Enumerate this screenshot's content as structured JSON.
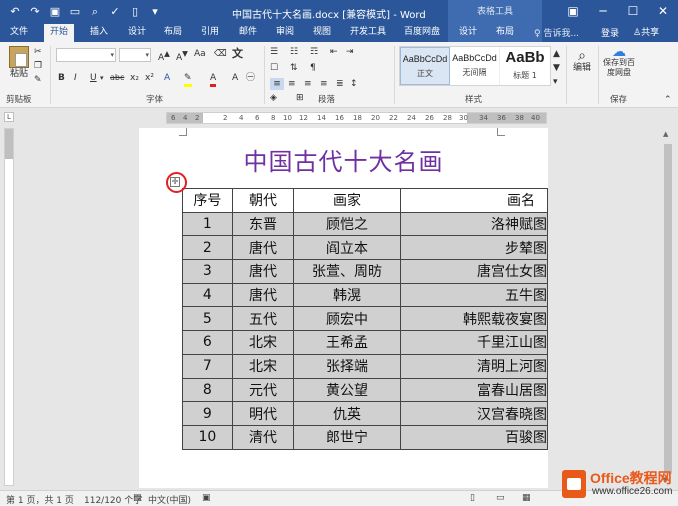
{
  "window": {
    "title": "中国古代十大名画.docx [兼容模式] - Word",
    "context_group": "表格工具"
  },
  "tabs": [
    "文件",
    "开始",
    "插入",
    "设计",
    "布局",
    "引用",
    "邮件",
    "审阅",
    "视图",
    "开发工具",
    "百度网盘",
    "设计",
    "布局"
  ],
  "active_tab": "开始",
  "tell_me": "告诉我...",
  "login": "登录",
  "share": "共享",
  "ribbon": {
    "groups": {
      "clipboard": "剪贴板",
      "font": "字体",
      "paragraph": "段落",
      "styles": "样式",
      "save": "保存"
    },
    "paste_label": "粘贴",
    "edit_label": "编辑",
    "save_to_baidu": "保存到百度网盘",
    "styles": [
      {
        "sample": "AaBbCcDd",
        "name": "正文"
      },
      {
        "sample": "AaBbCcDd",
        "name": "无间隔"
      },
      {
        "sample": "AaBb",
        "name": "标题 1"
      }
    ],
    "font_buttons": {
      "bold": "B",
      "italic": "I",
      "underline": "U",
      "strike": "abc",
      "sub": "x₂",
      "sup": "x²"
    }
  },
  "document": {
    "heading": "中国古代十大名画",
    "headers": [
      "序号",
      "朝代",
      "画家",
      "画名"
    ],
    "rows": [
      [
        "1",
        "东晋",
        "顾恺之",
        "洛神赋图"
      ],
      [
        "2",
        "唐代",
        "阎立本",
        "步辇图"
      ],
      [
        "3",
        "唐代",
        "张萱、周昉",
        "唐宫仕女图"
      ],
      [
        "4",
        "唐代",
        "韩滉",
        "五牛图"
      ],
      [
        "5",
        "五代",
        "顾宏中",
        "韩熙载夜宴图"
      ],
      [
        "6",
        "北宋",
        "王希孟",
        "千里江山图"
      ],
      [
        "7",
        "北宋",
        "张择端",
        "清明上河图"
      ],
      [
        "8",
        "元代",
        "黄公望",
        "富春山居图"
      ],
      [
        "9",
        "明代",
        "仇英",
        "汉宫春晓图"
      ],
      [
        "10",
        "清代",
        "郎世宁",
        "百骏图"
      ]
    ]
  },
  "statusbar": {
    "page": "第 1 页，共 1 页",
    "words": "112/120 个字",
    "language": "中文(中国)"
  },
  "watermark": {
    "brand": "Office教程网",
    "url": "www.office26.com"
  },
  "colors": {
    "titlebar": "#2b579a",
    "heading": "#7030a0",
    "cell_fill": "#d0d0d0",
    "highlight_ring": "#e02020"
  }
}
